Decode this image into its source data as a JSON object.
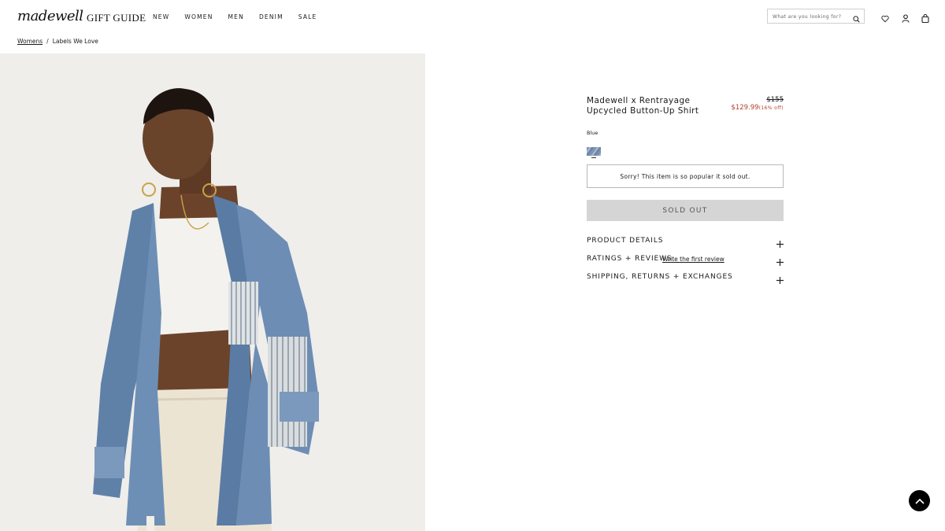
{
  "header": {
    "logo": "madewell",
    "gift_guide": "GIFT GUIDE",
    "nav": [
      "NEW",
      "WOMEN",
      "MEN",
      "DENIM",
      "SALE"
    ],
    "search_placeholder": "What are you looking for?",
    "icons": [
      "search-icon",
      "heart-icon",
      "account-icon",
      "bag-icon"
    ]
  },
  "breadcrumb": {
    "first": "Womens",
    "separator": "/",
    "current": "Labels We Love"
  },
  "product": {
    "name": "Madewell x Rentrayage Upcycled Button-Up Shirt",
    "price_original": "$155",
    "price_sale": "$129.99",
    "discount": "(16% off)",
    "color_label": "Blue",
    "sold_message": "Sorry! This item is so popular it sold out.",
    "sold_button": "SOLD OUT"
  },
  "accordion": {
    "details": "PRODUCT DETAILS",
    "ratings": "RATINGS + REVIEWS",
    "review_link": "Write the first review",
    "shipping": "SHIPPING, RETURNS + EXCHANGES"
  },
  "colors": {
    "sale": "#b3402b",
    "sold_button_bg": "#d5d5d5",
    "image_bg": "#efeeeb"
  }
}
